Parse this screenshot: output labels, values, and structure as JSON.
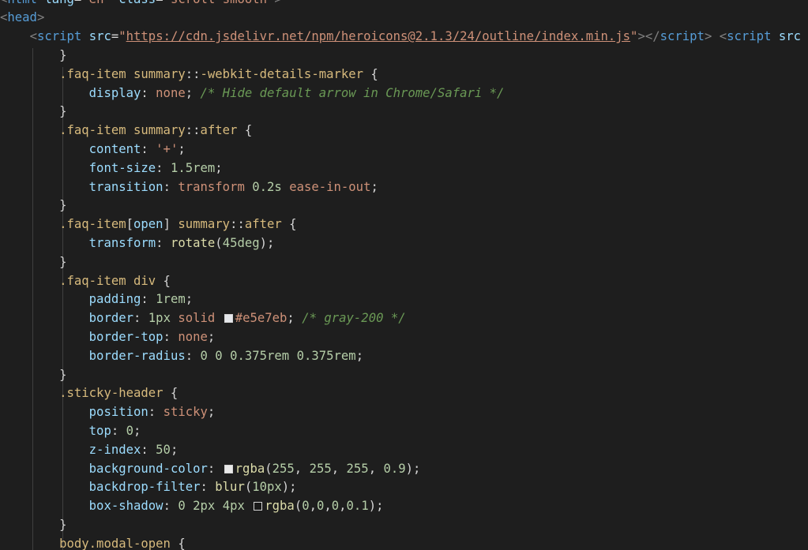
{
  "editor": {
    "language": "html",
    "theme_background": "#1e1e1e",
    "lines": [
      [
        [
          "t-br",
          "<"
        ],
        [
          "t-tag",
          "html"
        ],
        [
          "t-pun",
          " "
        ],
        [
          "t-attr",
          "lang"
        ],
        [
          "t-pun",
          "="
        ],
        [
          "t-str",
          "\"en\""
        ],
        [
          "t-pun",
          " "
        ],
        [
          "t-attr",
          "class"
        ],
        [
          "t-pun",
          "="
        ],
        [
          "t-str",
          "\"scroll-smooth\""
        ],
        [
          "t-br",
          ">"
        ]
      ],
      [
        [
          "t-br",
          "<"
        ],
        [
          "t-tag",
          "head"
        ],
        [
          "t-br",
          ">"
        ]
      ],
      [
        [
          "t-pun",
          "    "
        ],
        [
          "t-br",
          "<"
        ],
        [
          "t-tag",
          "script"
        ],
        [
          "t-pun",
          " "
        ],
        [
          "t-attr",
          "src"
        ],
        [
          "t-pun",
          "="
        ],
        [
          "t-str",
          "\""
        ],
        [
          "t-url",
          "https://cdn.jsdelivr.net/npm/heroicons@2.1.3/24/outline/index.min.js"
        ],
        [
          "t-str",
          "\""
        ],
        [
          "t-br",
          "></"
        ],
        [
          "t-tag",
          "script"
        ],
        [
          "t-br",
          ">"
        ],
        [
          "t-pun",
          " "
        ],
        [
          "t-br",
          "<"
        ],
        [
          "t-tag",
          "script"
        ],
        [
          "t-pun",
          " "
        ],
        [
          "t-attr",
          "src"
        ]
      ],
      [
        [
          "t-pun",
          "        "
        ],
        [
          "t-pun",
          "}"
        ]
      ],
      [
        [
          "t-pun",
          "        "
        ],
        [
          "t-sel",
          ".faq-item"
        ],
        [
          "t-pun",
          " "
        ],
        [
          "t-el",
          "summary"
        ],
        [
          "t-pun",
          "::"
        ],
        [
          "t-ps",
          "-webkit-details-marker"
        ],
        [
          "t-pun",
          " {"
        ]
      ],
      [
        [
          "t-pun",
          "            "
        ],
        [
          "t-prop",
          "display"
        ],
        [
          "t-pun",
          ": "
        ],
        [
          "t-val",
          "none"
        ],
        [
          "t-pun",
          "; "
        ],
        [
          "t-com",
          "/* Hide default arrow in Chrome/Safari */"
        ]
      ],
      [
        [
          "t-pun",
          "        "
        ],
        [
          "t-pun",
          "}"
        ]
      ],
      [
        [
          "t-pun",
          "        "
        ],
        [
          "t-sel",
          ".faq-item"
        ],
        [
          "t-pun",
          " "
        ],
        [
          "t-el",
          "summary"
        ],
        [
          "t-pun",
          "::"
        ],
        [
          "t-ps",
          "after"
        ],
        [
          "t-pun",
          " {"
        ]
      ],
      [
        [
          "t-pun",
          "            "
        ],
        [
          "t-prop",
          "content"
        ],
        [
          "t-pun",
          ": "
        ],
        [
          "t-str",
          "'+'"
        ],
        [
          "t-pun",
          ";"
        ]
      ],
      [
        [
          "t-pun",
          "            "
        ],
        [
          "t-prop",
          "font-size"
        ],
        [
          "t-pun",
          ": "
        ],
        [
          "t-num",
          "1.5rem"
        ],
        [
          "t-pun",
          ";"
        ]
      ],
      [
        [
          "t-pun",
          "            "
        ],
        [
          "t-prop",
          "transition"
        ],
        [
          "t-pun",
          ": "
        ],
        [
          "t-val",
          "transform"
        ],
        [
          "t-pun",
          " "
        ],
        [
          "t-num",
          "0.2s"
        ],
        [
          "t-pun",
          " "
        ],
        [
          "t-val",
          "ease-in-out"
        ],
        [
          "t-pun",
          ";"
        ]
      ],
      [
        [
          "t-pun",
          "        "
        ],
        [
          "t-pun",
          "}"
        ]
      ],
      [
        [
          "t-pun",
          "        "
        ],
        [
          "t-sel",
          ".faq-item"
        ],
        [
          "t-pun",
          "["
        ],
        [
          "t-attr",
          "open"
        ],
        [
          "t-pun",
          "]"
        ],
        [
          "t-pun",
          " "
        ],
        [
          "t-el",
          "summary"
        ],
        [
          "t-pun",
          "::"
        ],
        [
          "t-ps",
          "after"
        ],
        [
          "t-pun",
          " {"
        ]
      ],
      [
        [
          "t-pun",
          "            "
        ],
        [
          "t-prop",
          "transform"
        ],
        [
          "t-pun",
          ": "
        ],
        [
          "t-fn",
          "rotate"
        ],
        [
          "t-pun",
          "("
        ],
        [
          "t-num",
          "45deg"
        ],
        [
          "t-pun",
          ");"
        ]
      ],
      [
        [
          "t-pun",
          "        "
        ],
        [
          "t-pun",
          "}"
        ]
      ],
      [
        [
          "t-pun",
          "        "
        ],
        [
          "t-sel",
          ".faq-item"
        ],
        [
          "t-pun",
          " "
        ],
        [
          "t-el",
          "div"
        ],
        [
          "t-pun",
          " {"
        ]
      ],
      [
        [
          "t-pun",
          "            "
        ],
        [
          "t-prop",
          "padding"
        ],
        [
          "t-pun",
          ": "
        ],
        [
          "t-num",
          "1rem"
        ],
        [
          "t-pun",
          ";"
        ]
      ],
      [
        [
          "t-pun",
          "            "
        ],
        [
          "t-prop",
          "border"
        ],
        [
          "t-pun",
          ": "
        ],
        [
          "t-num",
          "1px"
        ],
        [
          "t-pun",
          " "
        ],
        [
          "t-val",
          "solid"
        ],
        [
          "t-pun",
          " "
        ],
        [
          "swatch",
          "#e5e7eb"
        ],
        [
          "t-val",
          "#e5e7eb"
        ],
        [
          "t-pun",
          "; "
        ],
        [
          "t-com",
          "/* gray-200 */"
        ]
      ],
      [
        [
          "t-pun",
          "            "
        ],
        [
          "t-prop",
          "border-top"
        ],
        [
          "t-pun",
          ": "
        ],
        [
          "t-val",
          "none"
        ],
        [
          "t-pun",
          ";"
        ]
      ],
      [
        [
          "t-pun",
          "            "
        ],
        [
          "t-prop",
          "border-radius"
        ],
        [
          "t-pun",
          ": "
        ],
        [
          "t-num",
          "0"
        ],
        [
          "t-pun",
          " "
        ],
        [
          "t-num",
          "0"
        ],
        [
          "t-pun",
          " "
        ],
        [
          "t-num",
          "0.375rem"
        ],
        [
          "t-pun",
          " "
        ],
        [
          "t-num",
          "0.375rem"
        ],
        [
          "t-pun",
          ";"
        ]
      ],
      [
        [
          "t-pun",
          "        "
        ],
        [
          "t-pun",
          "}"
        ]
      ],
      [
        [
          "t-pun",
          "        "
        ],
        [
          "t-sel",
          ".sticky-header"
        ],
        [
          "t-pun",
          " {"
        ]
      ],
      [
        [
          "t-pun",
          "            "
        ],
        [
          "t-prop",
          "position"
        ],
        [
          "t-pun",
          ": "
        ],
        [
          "t-val",
          "sticky"
        ],
        [
          "t-pun",
          ";"
        ]
      ],
      [
        [
          "t-pun",
          "            "
        ],
        [
          "t-prop",
          "top"
        ],
        [
          "t-pun",
          ": "
        ],
        [
          "t-num",
          "0"
        ],
        [
          "t-pun",
          ";"
        ]
      ],
      [
        [
          "t-pun",
          "            "
        ],
        [
          "t-prop",
          "z-index"
        ],
        [
          "t-pun",
          ": "
        ],
        [
          "t-num",
          "50"
        ],
        [
          "t-pun",
          ";"
        ]
      ],
      [
        [
          "t-pun",
          "            "
        ],
        [
          "t-prop",
          "background-color"
        ],
        [
          "t-pun",
          ": "
        ],
        [
          "swatch",
          "rgba(255,255,255,0.9)"
        ],
        [
          "t-fn",
          "rgba"
        ],
        [
          "t-pun",
          "("
        ],
        [
          "t-num",
          "255"
        ],
        [
          "t-pun",
          ", "
        ],
        [
          "t-num",
          "255"
        ],
        [
          "t-pun",
          ", "
        ],
        [
          "t-num",
          "255"
        ],
        [
          "t-pun",
          ", "
        ],
        [
          "t-num",
          "0.9"
        ],
        [
          "t-pun",
          ");"
        ]
      ],
      [
        [
          "t-pun",
          "            "
        ],
        [
          "t-prop",
          "backdrop-filter"
        ],
        [
          "t-pun",
          ": "
        ],
        [
          "t-fn",
          "blur"
        ],
        [
          "t-pun",
          "("
        ],
        [
          "t-num",
          "10px"
        ],
        [
          "t-pun",
          ");"
        ]
      ],
      [
        [
          "t-pun",
          "            "
        ],
        [
          "t-prop",
          "box-shadow"
        ],
        [
          "t-pun",
          ": "
        ],
        [
          "t-num",
          "0"
        ],
        [
          "t-pun",
          " "
        ],
        [
          "t-num",
          "2px"
        ],
        [
          "t-pun",
          " "
        ],
        [
          "t-num",
          "4px"
        ],
        [
          "t-pun",
          " "
        ],
        [
          "swatch",
          "rgba(0,0,0,0.1)"
        ],
        [
          "t-fn",
          "rgba"
        ],
        [
          "t-pun",
          "("
        ],
        [
          "t-num",
          "0"
        ],
        [
          "t-pun",
          ","
        ],
        [
          "t-num",
          "0"
        ],
        [
          "t-pun",
          ","
        ],
        [
          "t-num",
          "0"
        ],
        [
          "t-pun",
          ","
        ],
        [
          "t-num",
          "0.1"
        ],
        [
          "t-pun",
          ");"
        ]
      ],
      [
        [
          "t-pun",
          "        "
        ],
        [
          "t-pun",
          "}"
        ]
      ],
      [
        [
          "t-pun",
          "        "
        ],
        [
          "t-el",
          "body"
        ],
        [
          "t-sel",
          ".modal-open"
        ],
        [
          "t-pun",
          " {"
        ]
      ]
    ]
  }
}
